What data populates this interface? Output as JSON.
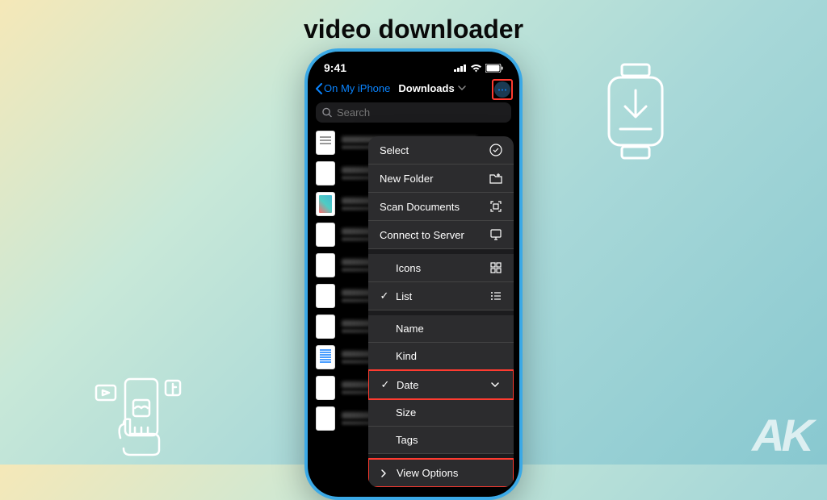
{
  "title": "video downloader",
  "status": {
    "time": "9:41"
  },
  "nav": {
    "back": "On My iPhone",
    "title": "Downloads"
  },
  "search": {
    "placeholder": "Search"
  },
  "menu": {
    "select": "Select",
    "newFolder": "New Folder",
    "scanDocs": "Scan Documents",
    "connectServer": "Connect to Server",
    "icons": "Icons",
    "list": "List",
    "name": "Name",
    "kind": "Kind",
    "date": "Date",
    "size": "Size",
    "tags": "Tags",
    "viewOptions": "View Options"
  },
  "logo": "AK"
}
